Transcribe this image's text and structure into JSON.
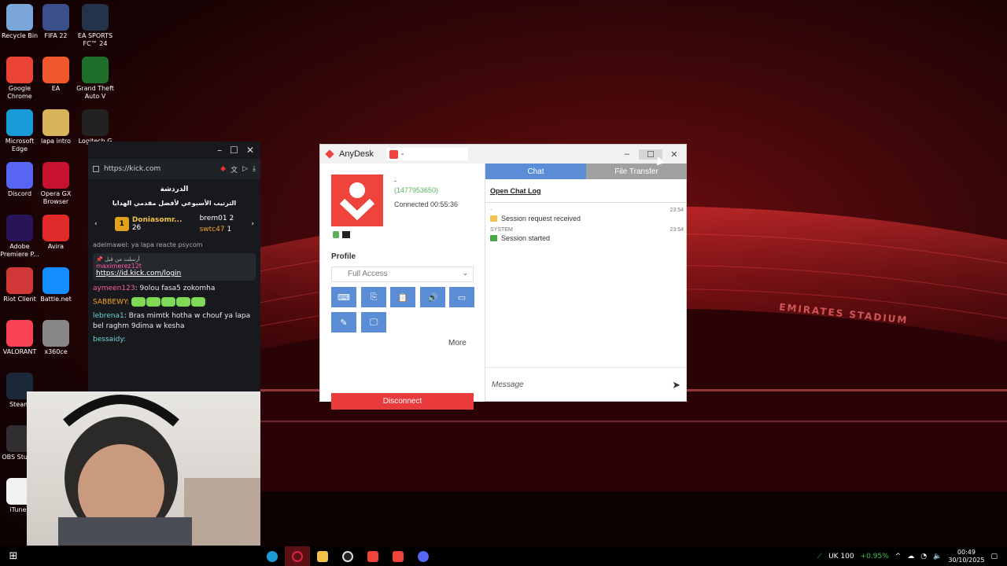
{
  "desktop": {
    "icons": [
      {
        "label": "Recycle Bin",
        "icon": "recycle-bin-icon",
        "color": "#7aa6d8"
      },
      {
        "label": "FIFA 22",
        "icon": "fifa-icon",
        "color": "#3b4f8a"
      },
      {
        "label": "EA SPORTS FC™ 24",
        "icon": "ea-fc-icon",
        "color": "#24324a"
      },
      {
        "label": "Google Chrome",
        "icon": "chrome-icon",
        "color": "#e84335"
      },
      {
        "label": "EA",
        "icon": "ea-icon",
        "color": "#f0572a"
      },
      {
        "label": "Grand Theft Auto V",
        "icon": "gta-icon",
        "color": "#1f6f2a"
      },
      {
        "label": "Microsoft Edge",
        "icon": "edge-icon",
        "color": "#1a9ad6"
      },
      {
        "label": "lapa intro",
        "icon": "folder-icon",
        "color": "#d9b45a"
      },
      {
        "label": "Logitech G",
        "icon": "logitech-icon",
        "color": "#222222"
      },
      {
        "label": "Discord",
        "icon": "discord-icon",
        "color": "#5865f2"
      },
      {
        "label": "Opera GX Browser",
        "icon": "opera-gx-icon",
        "color": "#c4122f"
      },
      {
        "label": "Adobe Premiere P...",
        "icon": "premiere-icon",
        "color": "#2a1458"
      },
      {
        "label": "Avira",
        "icon": "avira-icon",
        "color": "#e12a2a"
      },
      {
        "label": "Riot Client",
        "icon": "riot-icon",
        "color": "#d13639"
      },
      {
        "label": "Battle.net",
        "icon": "battlenet-icon",
        "color": "#148eff"
      },
      {
        "label": "VALORANT",
        "icon": "valorant-icon",
        "color": "#fa4454"
      },
      {
        "label": "x360ce",
        "icon": "gamepad-icon",
        "color": "#888888"
      },
      {
        "label": "Steam",
        "icon": "steam-icon",
        "color": "#1b2838"
      },
      {
        "label": "OBS Stud...",
        "icon": "obs-icon",
        "color": "#302e31"
      },
      {
        "label": "iTunes",
        "icon": "itunes-icon",
        "color": "#f2f2f2"
      }
    ]
  },
  "kick": {
    "url": "https://kick.com",
    "chat_title": "الدردشة",
    "chat_subtitle": "الترتيب الأسبوعي لأفضل مقدمي الهدايا",
    "gifters": [
      {
        "rank": "1",
        "name": "Doniasomr...",
        "count": "26"
      },
      {
        "name": "brem01",
        "count": "2"
      },
      {
        "name": "swtc47",
        "count": "1"
      }
    ],
    "top_msg": "adelmawel: ya lapa reacte psycom",
    "pinned_by": "أرسلت من قبل",
    "pinned_user": "maximerez12t",
    "pinned_link": "https://id.kick.com/login",
    "messages": [
      {
        "user": "aymeen123",
        "text": ": 9olou fasa5 zokomha",
        "color": "pink"
      },
      {
        "user": "SABBEWY:",
        "text": "",
        "color": "orange"
      },
      {
        "user": "lebrena1",
        "text": ": Bras mimtk hotha w chouf ya lapa bel raghm 9dima w kesha",
        "color": "cyan"
      },
      {
        "user": "bessaidy:",
        "text": "",
        "color": "cyan"
      }
    ]
  },
  "anydesk": {
    "title": "AnyDesk",
    "tab_label": "-",
    "remote_name": "-",
    "remote_id": "(1477953650)",
    "connected": "Connected 00:55:36",
    "profile_label": "Profile",
    "profile_value": "Full Access",
    "more_label": "More",
    "disconnect_label": "Disconnect",
    "tab_chat": "Chat",
    "tab_file": "File Transfer",
    "open_chat_log": "Open Chat Log",
    "entries": [
      {
        "who": "-",
        "time": "23:54",
        "text": "Session request received"
      },
      {
        "who": "SYSTEM",
        "time": "23:54",
        "text": "Session started"
      }
    ],
    "message_placeholder": "Message",
    "colors": {
      "accent": "#ef443b",
      "tab": "#5a8dd6"
    }
  },
  "wallpaper": {
    "sign": "EMIRATES STADIUM"
  },
  "taskbar": {
    "ticker": "UK 100",
    "change": "+0.95%",
    "time": "00:49",
    "date": "30/10/2025"
  }
}
